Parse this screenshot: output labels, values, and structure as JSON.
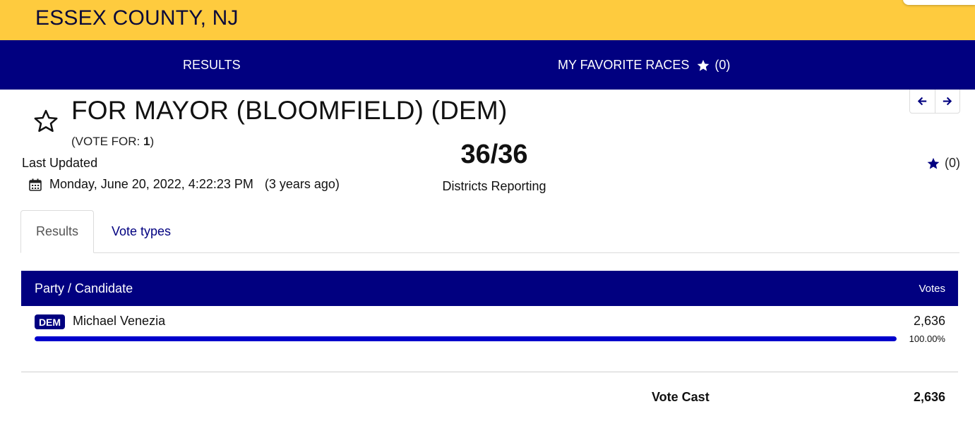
{
  "header": {
    "county": "ESSEX COUNTY, NJ",
    "brand_color": "#fecb3e",
    "nav_color": "#010080"
  },
  "nav": {
    "results": "RESULTS",
    "favorites": "MY FAVORITE RACES",
    "favorites_count": "(0)",
    "favorites_icon": "star-solid-icon"
  },
  "race": {
    "title": "FOR MAYOR (BLOOMFIELD) (DEM)",
    "vote_for_label": "(VOTE FOR: ",
    "vote_for_value": "1",
    "vote_for_close": ")",
    "last_updated_label": "Last Updated",
    "last_updated_value": "Monday, June 20, 2022, 4:22:23 PM",
    "last_updated_ago": "(3 years ago)",
    "reporting": "36/36",
    "reporting_label": "Districts Reporting",
    "favorite_count": "(0)"
  },
  "tabs": [
    {
      "label": "Results",
      "active": true
    },
    {
      "label": "Vote types",
      "active": false
    }
  ],
  "table": {
    "header_candidate": "Party / Candidate",
    "header_votes": "Votes",
    "rows": [
      {
        "party": "DEM",
        "name": "Michael Venezia",
        "votes": "2,636",
        "percent_label": "100.00%",
        "share": 1.0,
        "bar_color": "#0000cc"
      }
    ],
    "total_label": "Vote Cast",
    "total_value": "2,636"
  }
}
